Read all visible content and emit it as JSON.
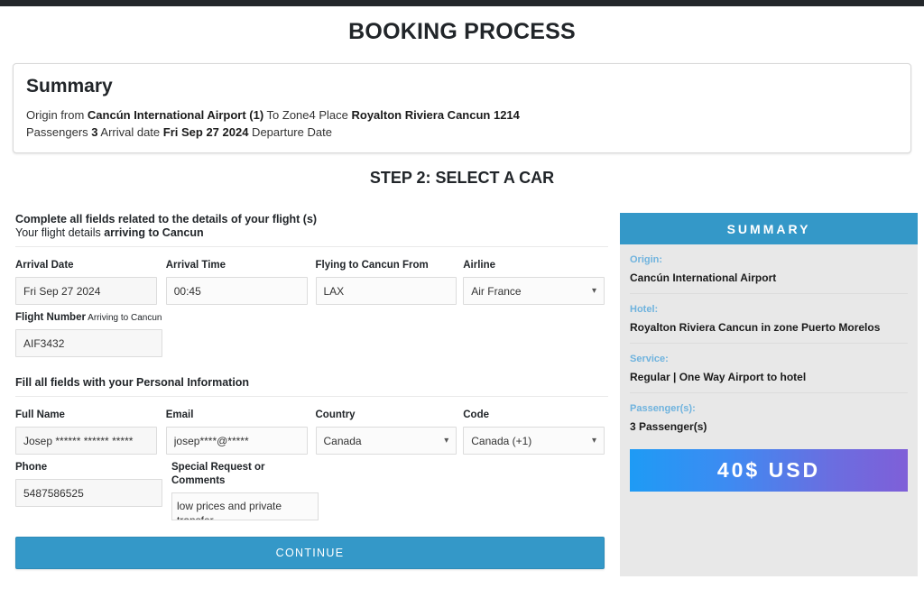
{
  "page": {
    "title": "BOOKING PROCESS",
    "step_title": "STEP 2: SELECT A CAR"
  },
  "summary_box": {
    "heading": "Summary",
    "line1_pre": "Origin from ",
    "line1_origin": "Cancún International Airport (1)",
    "line1_mid": " To Zone4 Place ",
    "line1_place": "Royalton Riviera Cancun 1214",
    "line2_pre": "Passengers ",
    "line2_passengers": "3",
    "line2_mid": " Arrival date ",
    "line2_date": "Fri Sep 27 2024",
    "line2_post": " Departure Date"
  },
  "flight_section": {
    "heading": "Complete all fields related to the details of your flight (s)",
    "subheading_pre": "Your flight details ",
    "subheading_bold": "arriving to Cancun",
    "arrival_date": {
      "label": "Arrival Date",
      "value": "Fri Sep 27 2024"
    },
    "arrival_time": {
      "label": "Arrival Time",
      "value": "00:45"
    },
    "flying_from": {
      "label": "Flying to Cancun From",
      "value": "LAX"
    },
    "airline": {
      "label": "Airline",
      "value": "Air France",
      "chevron": "chevron-down-icon"
    },
    "flight_number": {
      "label_bold": "Flight Number",
      "label_light": " Arriving to Cancun",
      "value": "AIF3432"
    }
  },
  "personal_section": {
    "heading": "Fill all fields with your Personal Information",
    "full_name": {
      "label": "Full Name",
      "value": "Josep ****** ****** *****"
    },
    "email": {
      "label": "Email",
      "value": "josep****@*****"
    },
    "country": {
      "label": "Country",
      "value": "Canada",
      "chevron": "chevron-down-icon"
    },
    "code": {
      "label": "Code",
      "value": "Canada (+1)",
      "chevron": "chevron-down-icon"
    },
    "phone": {
      "label": "Phone",
      "value": "5487586525"
    },
    "special_request": {
      "label": "Special Request or Comments",
      "value": "low prices and private transfer."
    }
  },
  "continue_button": {
    "label": "CONTINUE"
  },
  "sidebar": {
    "header": "SUMMARY",
    "items": [
      {
        "key": "Origin:",
        "value": "Cancún International Airport"
      },
      {
        "key": "Hotel:",
        "value": "Royalton Riviera Cancun in zone Puerto Morelos"
      },
      {
        "key": "Service:",
        "value": "Regular | One Way Airport to hotel"
      },
      {
        "key": "Passenger(s):",
        "value": "3 Passenger(s)"
      }
    ],
    "price_button": {
      "label": "40$ USD"
    }
  },
  "colors": {
    "accent_blue": "#3498c8",
    "side_key_blue": "#6fb3de",
    "sidebar_bg": "#e8e8e8",
    "topbar": "#23272b",
    "gradient_start": "#1e9bf5",
    "gradient_end": "#7f5fd8"
  }
}
